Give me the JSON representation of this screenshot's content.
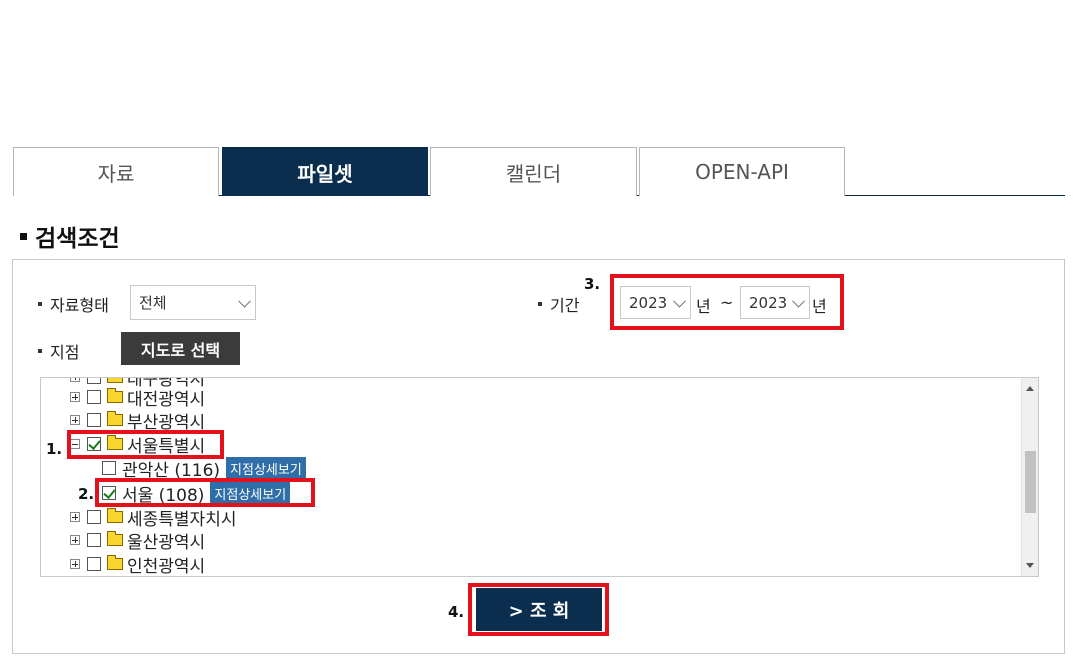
{
  "tabs": [
    {
      "label": "자료",
      "active": false
    },
    {
      "label": "파일셋",
      "active": true
    },
    {
      "label": "캘린더",
      "active": false
    },
    {
      "label": "OPEN-API",
      "active": false
    }
  ],
  "section_title": "검색조건",
  "filters": {
    "type_label": "자료형태",
    "type_value": "전체",
    "period_label": "기간",
    "period_start": "2023",
    "period_end": "2023",
    "year_unit": "년",
    "tilde": "~",
    "station_label": "지점",
    "map_button": "지도로 선택"
  },
  "tree": {
    "partial_top": "대구광역시",
    "items": [
      {
        "label": "대전광역시",
        "type": "folder",
        "expanded": false,
        "checked": false
      },
      {
        "label": "부산광역시",
        "type": "folder",
        "expanded": false,
        "checked": false
      },
      {
        "label": "서울특별시",
        "type": "folder",
        "expanded": true,
        "checked": true
      },
      {
        "label": "관악산 (116)",
        "type": "station",
        "checked": false,
        "badge": "지점상세보기"
      },
      {
        "label": "서울 (108)",
        "type": "station",
        "checked": true,
        "badge": "지점상세보기"
      },
      {
        "label": "세종특별자치시",
        "type": "folder",
        "expanded": false,
        "checked": false
      },
      {
        "label": "울산광역시",
        "type": "folder",
        "expanded": false,
        "checked": false
      },
      {
        "label": "인천광역시",
        "type": "folder",
        "expanded": false,
        "checked": false
      }
    ]
  },
  "steps": {
    "s1": "1.",
    "s2": "2.",
    "s3": "3.",
    "s4": "4."
  },
  "submit_label": "> 조 회",
  "colors": {
    "navy": "#0b2d4e",
    "highlight": "#e3121a",
    "badge": "#2f6ea8",
    "dark_button": "#3b3b3b"
  }
}
